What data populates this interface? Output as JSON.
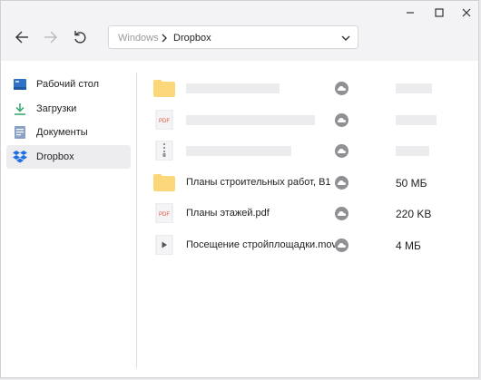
{
  "window": {
    "controls": [
      "minimize-icon",
      "maximize-icon",
      "close-icon"
    ]
  },
  "nav": {
    "back_icon": "arrow-left-icon",
    "forward_icon": "arrow-right-icon",
    "refresh_icon": "refresh-icon"
  },
  "address": {
    "root": "Windows",
    "current": "Dropbox"
  },
  "sidebar": {
    "items": [
      {
        "label": "Рабочий стол",
        "icon": "desktop-icon"
      },
      {
        "label": "Загрузки",
        "icon": "download-icon"
      },
      {
        "label": "Документы",
        "icon": "document-icon"
      },
      {
        "label": "Dropbox",
        "icon": "dropbox-icon",
        "active": true
      }
    ]
  },
  "files": [
    {
      "name": "",
      "size": "",
      "type": "folder",
      "placeholder": true
    },
    {
      "name": "",
      "size": "",
      "type": "pdf",
      "placeholder": true
    },
    {
      "name": "",
      "size": "",
      "type": "zip",
      "placeholder": true
    },
    {
      "name": "Планы строительных работ, В1",
      "size": "50 МБ",
      "type": "folder"
    },
    {
      "name": "Планы этажей.pdf",
      "size": "220 KB",
      "type": "pdf"
    },
    {
      "name": "Посещение стройплощадки.mov",
      "size": "4 МБ",
      "type": "video"
    }
  ],
  "colors": {
    "folder": "#fbd77a",
    "pdf_text": "#e0533c",
    "cloud": "#8f8f94",
    "dropbox": "#1f6fe0",
    "download": "#2ea36a",
    "desktop": "#2f73c7"
  },
  "labels": {
    "pdf_badge": "PDF"
  }
}
